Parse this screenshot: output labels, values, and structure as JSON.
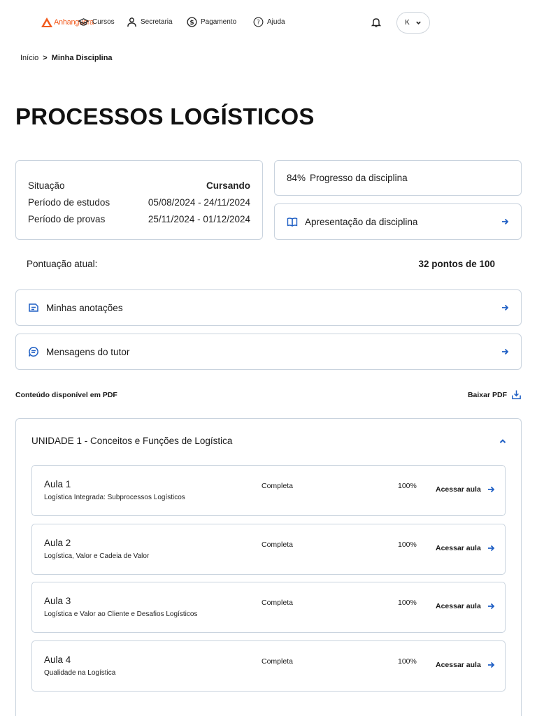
{
  "nav": {
    "logo_text": "Anhanguera",
    "items": [
      {
        "label": "Cursos",
        "icon": "graduation-cap-icon"
      },
      {
        "label": "Secretaria",
        "icon": "person-icon"
      },
      {
        "label": "Pagamento",
        "icon": "dollar-icon"
      },
      {
        "label": "Ajuda",
        "icon": "help-icon"
      }
    ],
    "avatar_initial": "K"
  },
  "breadcrumb": {
    "home": "Início",
    "separator": ">",
    "current": "Minha Disciplina"
  },
  "page_title": "PROCESSOS LOGÍSTICOS",
  "info": {
    "rows": [
      {
        "label": "Situação",
        "value": "Cursando"
      },
      {
        "label": "Período de estudos",
        "value": "05/08/2024 - 24/11/2024"
      },
      {
        "label": "Período de provas",
        "value": "25/11/2024 - 01/12/2024"
      }
    ]
  },
  "progress": {
    "percent_text": "84%",
    "label": "Progresso da disciplina",
    "value": 84
  },
  "apresentacao": {
    "label": "Apresentação da disciplina"
  },
  "score": {
    "label": "Pontuação atual:",
    "value": "32 pontos de 100"
  },
  "anotacoes": {
    "label": "Minhas anotações"
  },
  "mensagens": {
    "label": "Mensagens do tutor"
  },
  "pdf": {
    "label": "Conteúdo disponível em PDF",
    "button": "Baixar PDF"
  },
  "unit": {
    "title": "UNIDADE 1 - Conceitos e Funções de Logística",
    "lessons": [
      {
        "title": "Aula 1",
        "subtitle": "Logística Integrada: Subprocessos Logísticos",
        "status": "Completa",
        "percent": "100%",
        "button": "Acessar aula"
      },
      {
        "title": "Aula 2",
        "subtitle": "Logística, Valor e Cadeia de Valor",
        "status": "Completa",
        "percent": "100%",
        "button": "Acessar aula"
      },
      {
        "title": "Aula 3",
        "subtitle": "Logística e Valor ao Cliente e Desafios Logísticos",
        "status": "Completa",
        "percent": "100%",
        "button": "Acessar aula"
      },
      {
        "title": "Aula 4",
        "subtitle": "Qualidade na Logística",
        "status": "Completa",
        "percent": "100%",
        "button": "Acessar aula"
      }
    ]
  },
  "colors": {
    "accent": "#1f5fc4",
    "brand": "#f25a1d",
    "border": "#c9d3de"
  }
}
